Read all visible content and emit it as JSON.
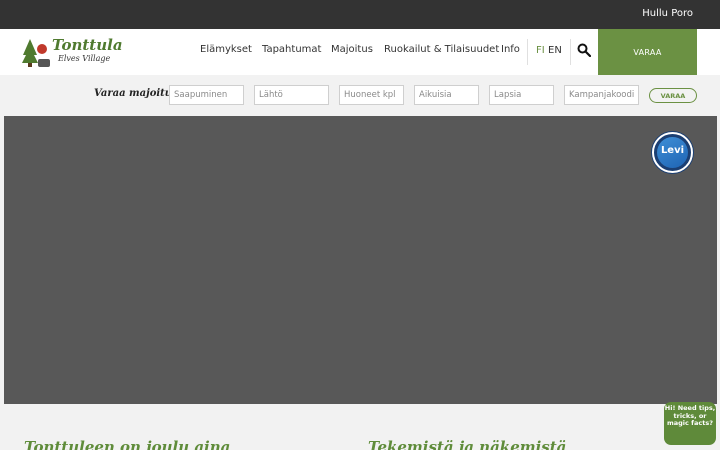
{
  "topbar": {
    "link": "Hullu Poro"
  },
  "logo": {
    "line1": "Tonttula",
    "line2": "Elves Village"
  },
  "nav": {
    "items": [
      {
        "label": "Elämykset"
      },
      {
        "label": "Tapahtumat"
      },
      {
        "label": "Majoitus"
      },
      {
        "label": "Ruokailut & Tilaisuudet"
      },
      {
        "label": "Info"
      }
    ],
    "lang_fi": "FI",
    "lang_en": "EN",
    "book_label": "VARAA"
  },
  "booking": {
    "title": "Varaa majoitus",
    "fields": {
      "arrival": "Saapuminen",
      "departure": "Lähtö",
      "rooms": "Huoneet kpl",
      "adults": "Aikuisia",
      "children": "Lapsia",
      "campaign": "Kampanjakoodi"
    },
    "button": "VARAA"
  },
  "hero": {
    "badge": "Levi"
  },
  "sections": {
    "left_title": "Tonttuleen on joulu aina",
    "right_title": "Tekemistä ja näkemistä"
  },
  "chat": {
    "text": "Hi! Need tips, tricks, or magic facts?"
  },
  "colors": {
    "brand_green": "#6b9143",
    "topbar": "#333333",
    "hero": "#585858",
    "levi_blue": "#1b3f73"
  }
}
